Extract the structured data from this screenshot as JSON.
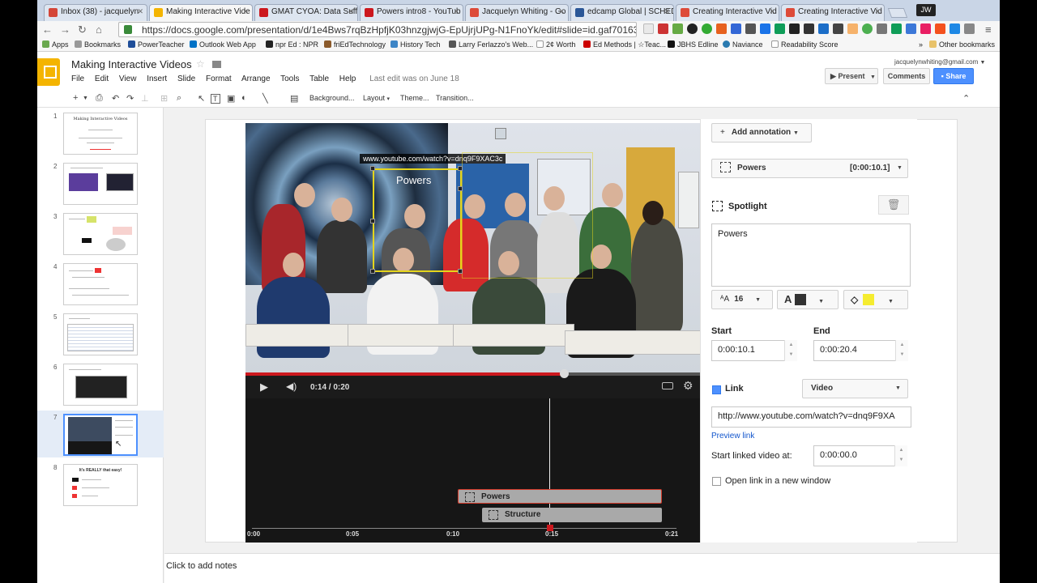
{
  "browser": {
    "tabs": [
      {
        "label": "Inbox (38) - jacquelyn",
        "color": "#d44638"
      },
      {
        "label": "Making Interactive Vide",
        "color": "#f4b400",
        "active": true
      },
      {
        "label": "GMAT CYOA: Data Suff",
        "color": "#cc181e"
      },
      {
        "label": "Powers intro8 - YouTub",
        "color": "#cc181e"
      },
      {
        "label": "Jacquelyn Whiting - Go",
        "color": "#dd4b39"
      },
      {
        "label": "edcamp Global | SCHED",
        "color": "#2b5797"
      },
      {
        "label": "Creating Interactive Vid",
        "color": "#dd4b39"
      },
      {
        "label": "Creating Interactive Vid",
        "color": "#dd4b39"
      }
    ],
    "user_badge": "JW",
    "url": "https://docs.google.com/presentation/d/1e4Bws7rqBzHpfjK03hnzgjwjG-EpUjrjUPg-N1FnoYk/edit#slide=id.gaf70163",
    "bookmarks": [
      "Apps",
      "Bookmarks",
      "PowerTeacher",
      "Outlook Web App",
      "npr Ed : NPR",
      "friEdTechnology",
      "History Tech",
      "Larry Ferlazzo's Web...",
      "2¢ Worth",
      "Ed Methods | ☆Teac...",
      "JBHS Edline",
      "Naviance",
      "Readability Score"
    ],
    "other_bookmarks": "Other bookmarks"
  },
  "docs": {
    "title": "Making Interactive Videos",
    "menu": [
      "File",
      "Edit",
      "View",
      "Insert",
      "Slide",
      "Format",
      "Arrange",
      "Tools",
      "Table",
      "Help"
    ],
    "last_edit": "Last edit was on June 18",
    "account": "jacquelynwhiting@gmail.com",
    "present": "Present",
    "comments": "Comments",
    "share": "Share",
    "toolbar": {
      "background": "Background...",
      "layout": "Layout",
      "theme": "Theme...",
      "transition": "Transition..."
    }
  },
  "slides": {
    "numbers": [
      "1",
      "2",
      "3",
      "4",
      "5",
      "6",
      "7",
      "8"
    ],
    "thumb1_title": "Making Interactive Videos",
    "thumb8_title": "It's REALLY that easy!"
  },
  "video": {
    "overlay_url": "www.youtube.com/watch?v=dnq9F9XAC3c",
    "spotlight_label": "Powers",
    "time": "0:14 / 0:20",
    "progress": 0.7
  },
  "timeline": {
    "ticks": [
      "0:00",
      "0:05",
      "0:10",
      "0:15",
      "0:21"
    ],
    "tracks": [
      "Powers",
      "Structure"
    ]
  },
  "panel": {
    "add_annotation": "Add annotation",
    "selected_annotation": "Powers",
    "selected_time": "[0:00:10.1]",
    "type": "Spotlight",
    "text": "Powers",
    "font_size": "16",
    "text_color": "#333333",
    "fill_color": "#f5ec30",
    "start_label": "Start",
    "end_label": "End",
    "start": "0:00:10.1",
    "end": "0:00:20.4",
    "link_label": "Link",
    "link_type": "Video",
    "link_url": "http://www.youtube.com/watch?v=dnq9F9XA",
    "preview_link": "Preview link",
    "start_linked_label": "Start linked video at:",
    "start_linked": "0:00:00.0",
    "open_new_window": "Open link in a new window"
  },
  "notes_placeholder": "Click to add notes"
}
